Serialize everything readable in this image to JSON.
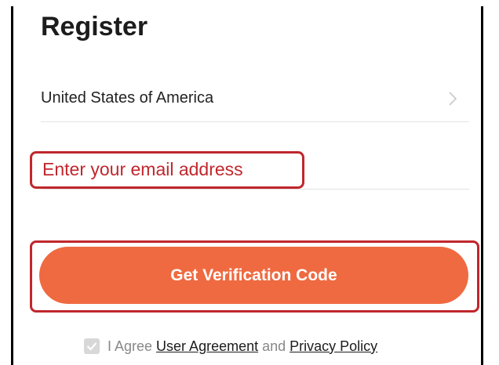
{
  "page": {
    "title": "Register"
  },
  "country": {
    "value": "United States of America",
    "icon": "chevron-right-icon"
  },
  "email": {
    "placeholder": "Enter your email address",
    "value": ""
  },
  "button": {
    "label": "Get Verification Code",
    "color": "#ef6a40"
  },
  "agreement": {
    "checked": true,
    "prefix": "I Agree",
    "user_agreement": "User Agreement",
    "conjunction": "and",
    "privacy_policy": "Privacy Policy"
  },
  "colors": {
    "accent": "#ef6a40",
    "highlight": "#c0272d"
  }
}
